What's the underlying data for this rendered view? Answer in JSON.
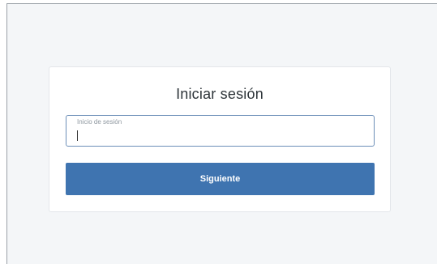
{
  "login": {
    "title": "Iniciar sesión",
    "field_label": "Inicio de sesión",
    "field_value": "",
    "button_label": "Siguiente"
  },
  "colors": {
    "accent": "#3f74b0",
    "background": "#f4f6f8"
  }
}
